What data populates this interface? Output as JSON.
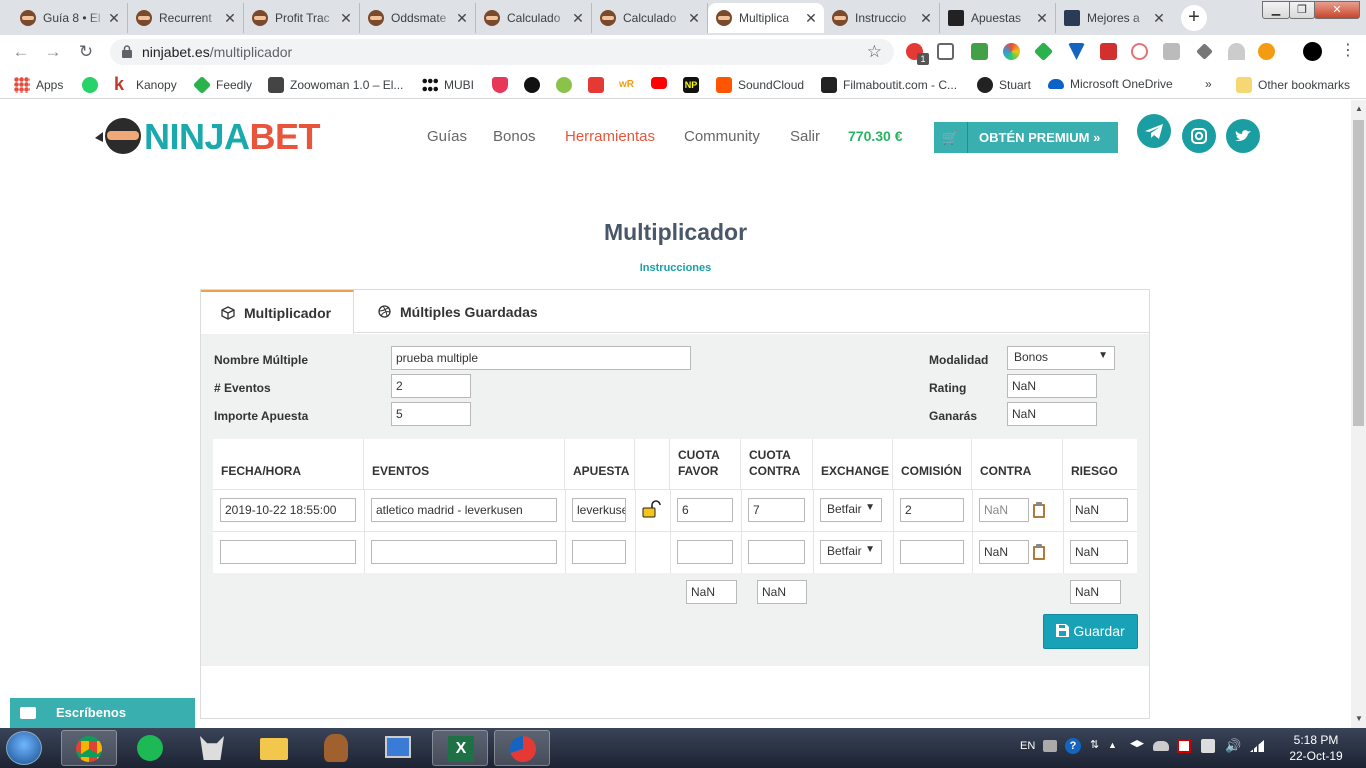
{
  "browser": {
    "tabs": [
      {
        "title": "Guía 8 • El"
      },
      {
        "title": "Recurrent"
      },
      {
        "title": "Profit Trac"
      },
      {
        "title": "Oddsmate"
      },
      {
        "title": "Calculado"
      },
      {
        "title": "Calculado"
      },
      {
        "title": "Multiplica"
      },
      {
        "title": "Instruccio"
      },
      {
        "title": "Apuestas"
      },
      {
        "title": "Mejores a"
      }
    ],
    "url_host": "ninjabet.es",
    "url_path": "/multiplicador",
    "extension_badge": "1",
    "bookmarks": [
      {
        "label": "Apps",
        "color": "#e74c3c"
      },
      {
        "label": "",
        "color": "#25d366"
      },
      {
        "label": "Kanopy",
        "color": "#c0392b"
      },
      {
        "label": "Feedly",
        "color": "#2bb24c"
      },
      {
        "label": "Zoowoman 1.0 – El...",
        "color": "#444444"
      },
      {
        "label": "MUBI",
        "color": "#111111"
      },
      {
        "label": "",
        "color": "#e8385a"
      },
      {
        "label": "",
        "color": "#1db954"
      },
      {
        "label": "",
        "color": "#8bc34a"
      },
      {
        "label": "",
        "color": "#e53935"
      },
      {
        "label": "",
        "color": "#f39c12"
      },
      {
        "label": "",
        "color": "#ff0000"
      },
      {
        "label": "",
        "color": "#111111"
      },
      {
        "label": "SoundCloud",
        "color": "#ff5500"
      },
      {
        "label": "Filmaboutit.com - C...",
        "color": "#222222"
      },
      {
        "label": "Stuart",
        "color": "#222222"
      },
      {
        "label": "Microsoft OneDrive",
        "color": "#0a64c8"
      }
    ],
    "bookmarks_more": "»",
    "other_bookmarks": "Other bookmarks"
  },
  "site": {
    "logo_ninja": "NINJA",
    "logo_bet": "BET",
    "nav": [
      "Guías",
      "Bonos",
      "Herramientas",
      "Community",
      "Salir"
    ],
    "active_nav": "Herramientas",
    "balance": "770.30 €",
    "premium_label": "OBTÉN PREMIUM »"
  },
  "page": {
    "title": "Multiplicador",
    "instructions_link": "Instrucciones",
    "tabs": [
      "Multiplicador",
      "Múltiples Guardadas"
    ]
  },
  "form": {
    "nombre_label": "Nombre Múltiple",
    "nombre_value": "prueba multiple",
    "eventos_label": "# Eventos",
    "eventos_value": "2",
    "importe_label": "Importe Apuesta",
    "importe_value": "5",
    "modalidad_label": "Modalidad",
    "modalidad_value": "Bonos",
    "rating_label": "Rating",
    "rating_value": "NaN",
    "ganaras_label": "Ganarás",
    "ganaras_value": "NaN"
  },
  "table": {
    "headers": [
      "FECHA/HORA",
      "EVENTOS",
      "APUESTA",
      "",
      "CUOTA\nFAVOR",
      "CUOTA\nCONTRA",
      "EXCHANGE",
      "COMISIÓN",
      "CONTRA",
      "RIESGO"
    ],
    "rows": [
      {
        "fecha": "2019-10-22 18:55:00",
        "evento": "atletico madrid - leverkusen",
        "apuesta": "leverkusen",
        "cuota_favor": "6",
        "cuota_contra": "7",
        "exchange": "Betfair",
        "comision": "2",
        "contra": "NaN",
        "riesgo": "NaN"
      },
      {
        "fecha": "",
        "evento": "",
        "apuesta": "",
        "cuota_favor": "",
        "cuota_contra": "",
        "exchange": "Betfair",
        "comision": "",
        "contra": "NaN",
        "riesgo": "NaN"
      }
    ],
    "totals": {
      "cuota_favor": "NaN",
      "cuota_contra": "NaN",
      "riesgo": "NaN"
    }
  },
  "buttons": {
    "guardar": "Guardar"
  },
  "chat": {
    "label": "Escríbenos"
  },
  "taskbar": {
    "lang": "EN",
    "time": "5:18 PM",
    "date": "22-Oct-19"
  }
}
